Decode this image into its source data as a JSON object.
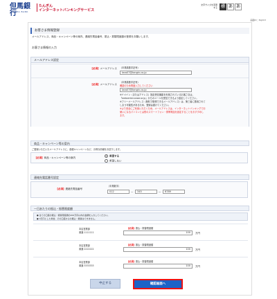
{
  "header": {
    "logo_main": "但馬銀行",
    "logo_sub": "TAJIMA BANK",
    "service_line1": "たんぎん",
    "service_line2": "インターネットバンキングサービス",
    "font_size_label": "文字サイズを変更する",
    "font_std": "標",
    "font_mid": "あ",
    "font_large": "あ"
  },
  "page_id": "画面ID：BLJ003",
  "page_title": "お客さま情報登録",
  "description": "メールアドレス、商品・キャンペーン等の案内、連絡先電話番号、振込・振替限度額の登録をお願いします。",
  "subsection_title": "お客さま情報の入力",
  "email_section": {
    "title": "メールアドレス設定",
    "required": "【必須】",
    "label1": "メールアドレス",
    "hint1": "（半角英数字記号）",
    "value1": "taro07@tangin.co.jp",
    "label2": "メールアドレス",
    "hint2": "（半角英数字記号）",
    "confirm_note": "確認のため再度入力してください",
    "value2": "taro07@tangin.co.jp",
    "note1": "※ドメイン（またはアドレス）指定受信機能を利用されているお客さまは、",
    "note2": "「webcenter.anser.or.jp」からのメールを受信できるよう設定してください。",
    "note3": "※フリーメールアドレス（無料で取得できるメールアドレス）は、第三者に悪用されて",
    "note4": "しまう可能性があるため、登録は避けてください。",
    "note5": "※より安全にご利用いただくため、メールアドレスは、インターネットバンキングでお",
    "note6": "使いになるパソコンとは別のスマートフォン・携帯電話を設定することをおすすめし",
    "note7": "ます。"
  },
  "campaign_section": {
    "title": "商品・キャンペーン等の案内",
    "description": "ご登録いただいたメールアドレスに、各種キャンペーンなど、お得な情報をお送りします。",
    "required": "【必須】",
    "label": "商品・キャンペーン等の案内",
    "option_yes": "希望する",
    "option_no": "希望しない"
  },
  "phone_section": {
    "title": "連絡先電話番号設定",
    "required": "【必須】",
    "label": "連絡先電話番号",
    "hint": "（半角数字）",
    "part1": "012",
    "part2": "345",
    "part3": "6789",
    "dash": "—"
  },
  "limits_section": {
    "title": "一日あたりの振込・振替限度額",
    "notice1": "● 全ての口座の振込・振替限度額の200万円以内の金額を入力してください。",
    "notice2": "● 0万円とした場合、その口座からの振込・振替はできません。",
    "branch_label": "本店営業部",
    "account_type": "普通",
    "required": "【必須】",
    "limit_label": "振込・振替限度額",
    "unit": "万円",
    "accounts": [
      {
        "number": "1111111",
        "value": "100"
      },
      {
        "number": "2222222",
        "value": "100"
      },
      {
        "number": "3333333",
        "value": "100"
      }
    ]
  },
  "buttons": {
    "cancel": "中止する",
    "confirm": "確認画面へ"
  }
}
